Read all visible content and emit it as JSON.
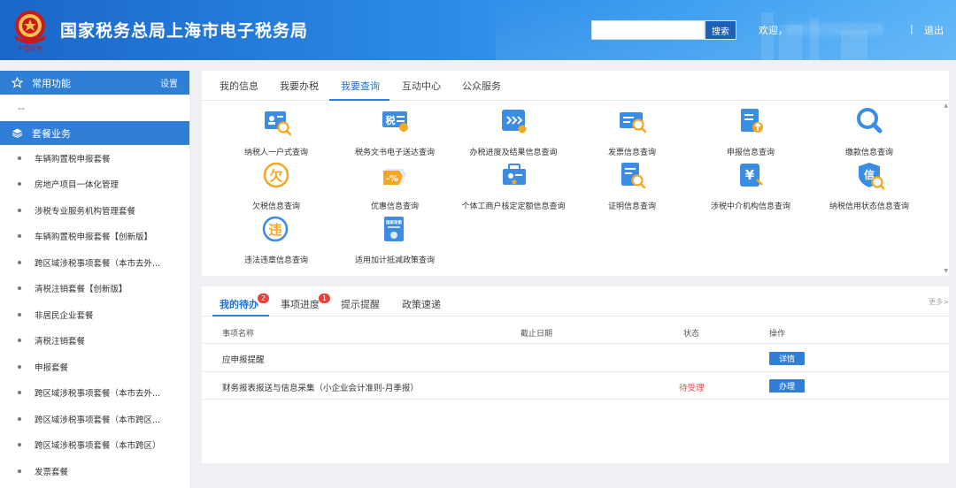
{
  "header": {
    "title": "国家税务总局上海市电子税务局",
    "search_placeholder": "",
    "search_button": "搜索",
    "welcome": "欢迎，",
    "separator": "|",
    "logout": "退出",
    "emblem_text": "中国税务"
  },
  "sidebar": {
    "common_title": "常用功能",
    "common_setting": "设置",
    "common_placeholder": "--",
    "package_title": "套餐业务",
    "items": [
      {
        "label": "车辆购置税申报套餐"
      },
      {
        "label": "房地产项目一体化管理"
      },
      {
        "label": "涉税专业服务机构管理套餐"
      },
      {
        "label": "车辆购置税申报套餐【创新版】"
      },
      {
        "label": "跨区域涉税事项套餐（本市去外..."
      },
      {
        "label": "清税注销套餐【创新版】"
      },
      {
        "label": "非居民企业套餐"
      },
      {
        "label": "清税注销套餐"
      },
      {
        "label": "申报套餐"
      },
      {
        "label": "跨区域涉税事项套餐（本市去外..."
      },
      {
        "label": "跨区域涉税事项套餐（本市跨区..."
      },
      {
        "label": "跨区域涉税事项套餐（本市跨区）"
      },
      {
        "label": "发票套餐"
      }
    ]
  },
  "main_tabs": {
    "tabs": [
      "我的信息",
      "我要办税",
      "我要查询",
      "互动中心",
      "公众服务"
    ],
    "active": "我要查询"
  },
  "query_items": [
    {
      "label": "纳税人一户式查询",
      "icon": "taxpayer-info-icon"
    },
    {
      "label": "税务文书电子送达查询",
      "icon": "tax-document-icon"
    },
    {
      "label": "办税进度及结果信息查询",
      "icon": "progress-icon"
    },
    {
      "label": "发票信息查询",
      "icon": "invoice-icon"
    },
    {
      "label": "申报信息查询",
      "icon": "declaration-icon"
    },
    {
      "label": "缴款信息查询",
      "icon": "payment-search-icon"
    },
    {
      "label": "欠税信息查询",
      "icon": "arrears-icon"
    },
    {
      "label": "优惠信息查询",
      "icon": "discount-icon"
    },
    {
      "label": "个体工商户核定定额信息查询",
      "icon": "business-icon"
    },
    {
      "label": "证明信息查询",
      "icon": "certificate-icon"
    },
    {
      "label": "涉税中介机构信息查询",
      "icon": "agency-icon"
    },
    {
      "label": "纳税信用状态信息查询",
      "icon": "credit-icon"
    },
    {
      "label": "违法违章信息查询",
      "icon": "violation-icon"
    },
    {
      "label": "适用加计抵减政策查询",
      "icon": "policy-icon"
    }
  ],
  "icon_glyphs": {
    "tax": "税",
    "owe": "欠",
    "percent": "-%",
    "yen": "¥",
    "credit": "信",
    "violation": "违",
    "policy": "国家政策"
  },
  "todo": {
    "tabs": [
      {
        "label": "我的待办",
        "badge": "2"
      },
      {
        "label": "事项进度",
        "badge": "1"
      },
      {
        "label": "提示提醒",
        "badge": ""
      },
      {
        "label": "政策速递",
        "badge": ""
      }
    ],
    "more": "更多>",
    "columns": [
      "事项名称",
      "截止日期",
      "状态",
      "操作"
    ],
    "rows": [
      {
        "name": "应申报提醒",
        "deadline": "",
        "status": "",
        "action": "详情"
      },
      {
        "name": "财务报表报送与信息采集（小企业会计准则-月季报）",
        "deadline": "",
        "status": "待受理",
        "action": "办理"
      }
    ]
  },
  "colors": {
    "primary": "#2f7fd7",
    "header_dark": "#1a66c9",
    "badge_red": "#e8413c",
    "status_red": "#d9534f"
  }
}
